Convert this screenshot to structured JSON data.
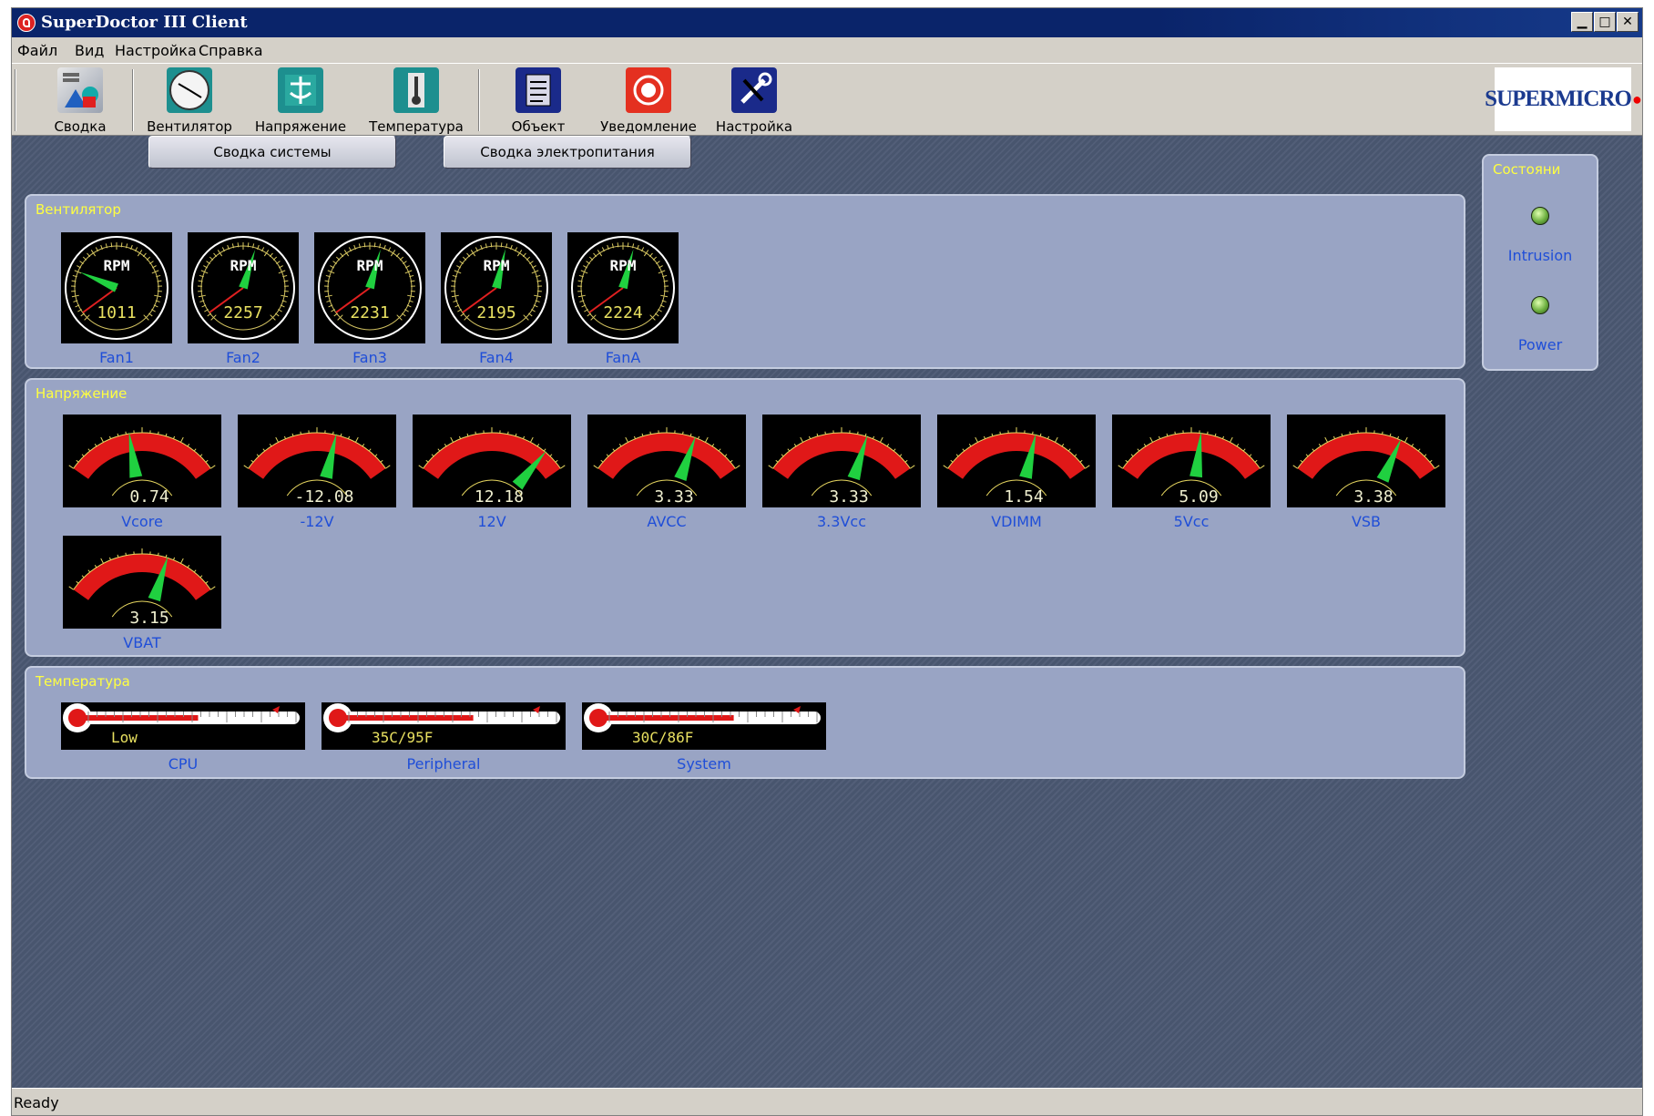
{
  "window": {
    "title": "SuperDoctor III Client"
  },
  "menu": [
    "Файл",
    "Вид",
    "Настройка",
    "Справка"
  ],
  "toolbar": [
    {
      "label": "Сводка",
      "icon": "summary-icon"
    },
    {
      "label": "Вентилятор",
      "icon": "fan-icon"
    },
    {
      "label": "Напряжение",
      "icon": "voltage-icon"
    },
    {
      "label": "Температура",
      "icon": "thermometer-icon"
    },
    {
      "label": "Объект",
      "icon": "object-icon"
    },
    {
      "label": "Уведомление",
      "icon": "alarm-icon"
    },
    {
      "label": "Настройка",
      "icon": "wrench-icon"
    }
  ],
  "logo": {
    "text": "SUPERMICRO"
  },
  "tabs": [
    "Сводка системы",
    "Сводка электропитания"
  ],
  "fan_panel": {
    "title": "Вентилятор",
    "unit": "RPM",
    "fans": [
      {
        "label": "Fan1",
        "value": "1011"
      },
      {
        "label": "Fan2",
        "value": "2257"
      },
      {
        "label": "Fan3",
        "value": "2231"
      },
      {
        "label": "Fan4",
        "value": "2195"
      },
      {
        "label": "FanA",
        "value": "2224"
      }
    ]
  },
  "voltage_panel": {
    "title": "Напряжение",
    "gauges": [
      {
        "label": "Vcore",
        "value": "0.74",
        "fraction": 0.42
      },
      {
        "label": "-12V",
        "value": "-12.08",
        "fraction": 0.62
      },
      {
        "label": "12V",
        "value": "12.18",
        "fraction": 0.86
      },
      {
        "label": "AVCC",
        "value": "3.33",
        "fraction": 0.68
      },
      {
        "label": "3.3Vcc",
        "value": "3.33",
        "fraction": 0.66
      },
      {
        "label": "VDIMM",
        "value": "1.54",
        "fraction": 0.62
      },
      {
        "label": "5Vcc",
        "value": "5.09",
        "fraction": 0.56
      },
      {
        "label": "VSB",
        "value": "3.38",
        "fraction": 0.72
      },
      {
        "label": "VBAT",
        "value": "3.15",
        "fraction": 0.66
      }
    ]
  },
  "temperature_panel": {
    "title": "Температура",
    "sensors": [
      {
        "label": "CPU",
        "value": "Low",
        "fraction": 0.55
      },
      {
        "label": "Peripheral",
        "value": "35C/95F",
        "fraction": 0.62
      },
      {
        "label": "System",
        "value": "30C/86F",
        "fraction": 0.62
      }
    ]
  },
  "status_panel": {
    "title": "Состояни",
    "items": [
      {
        "label": "Intrusion",
        "state": "ok"
      },
      {
        "label": "Power",
        "state": "ok"
      }
    ]
  },
  "statusbar": {
    "text": "Ready"
  }
}
